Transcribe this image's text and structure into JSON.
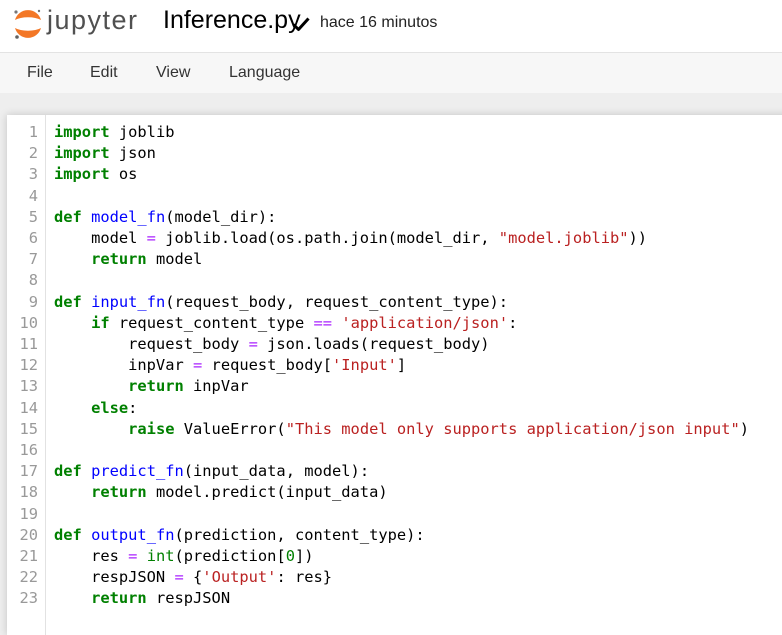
{
  "header": {
    "logo_text": "jupyter",
    "notebook_name": "Inference.py",
    "save_status": "hace 16 minutos"
  },
  "menu": [
    "File",
    "Edit",
    "View",
    "Language"
  ],
  "colors": {
    "keyword": "#008000",
    "function_name": "#0000ff",
    "string": "#ba2121",
    "operator": "#aa22ff",
    "number": "#008000",
    "line_number": "#999999",
    "logo_orange": "#f37726"
  },
  "code": [
    {
      "n": "1",
      "t": [
        {
          "c": "import",
          "k": "kw"
        },
        {
          "c": " joblib",
          "k": "plain"
        }
      ]
    },
    {
      "n": "2",
      "t": [
        {
          "c": "import",
          "k": "kw"
        },
        {
          "c": " json",
          "k": "plain"
        }
      ]
    },
    {
      "n": "3",
      "t": [
        {
          "c": "import",
          "k": "kw"
        },
        {
          "c": " os",
          "k": "plain"
        }
      ]
    },
    {
      "n": "4",
      "t": []
    },
    {
      "n": "5",
      "t": [
        {
          "c": "def",
          "k": "kw"
        },
        {
          "c": " ",
          "k": "plain"
        },
        {
          "c": "model_fn",
          "k": "def"
        },
        {
          "c": "(model_dir):",
          "k": "plain"
        }
      ]
    },
    {
      "n": "6",
      "t": [
        {
          "c": "    model ",
          "k": "plain"
        },
        {
          "c": "=",
          "k": "op"
        },
        {
          "c": " joblib.load(os.path.join(model_dir, ",
          "k": "plain"
        },
        {
          "c": "\"model.joblib\"",
          "k": "str"
        },
        {
          "c": "))",
          "k": "plain"
        }
      ]
    },
    {
      "n": "7",
      "t": [
        {
          "c": "    ",
          "k": "plain"
        },
        {
          "c": "return",
          "k": "kw"
        },
        {
          "c": " model",
          "k": "plain"
        }
      ]
    },
    {
      "n": "8",
      "t": []
    },
    {
      "n": "9",
      "t": [
        {
          "c": "def",
          "k": "kw"
        },
        {
          "c": " ",
          "k": "plain"
        },
        {
          "c": "input_fn",
          "k": "def"
        },
        {
          "c": "(request_body, request_content_type):",
          "k": "plain"
        }
      ]
    },
    {
      "n": "10",
      "t": [
        {
          "c": "    ",
          "k": "plain"
        },
        {
          "c": "if",
          "k": "kw"
        },
        {
          "c": " request_content_type ",
          "k": "plain"
        },
        {
          "c": "==",
          "k": "op"
        },
        {
          "c": " ",
          "k": "plain"
        },
        {
          "c": "'application/json'",
          "k": "str"
        },
        {
          "c": ":",
          "k": "plain"
        }
      ]
    },
    {
      "n": "11",
      "t": [
        {
          "c": "        request_body ",
          "k": "plain"
        },
        {
          "c": "=",
          "k": "op"
        },
        {
          "c": " json.loads(request_body)",
          "k": "plain"
        }
      ]
    },
    {
      "n": "12",
      "t": [
        {
          "c": "        inpVar ",
          "k": "plain"
        },
        {
          "c": "=",
          "k": "op"
        },
        {
          "c": " request_body[",
          "k": "plain"
        },
        {
          "c": "'Input'",
          "k": "str"
        },
        {
          "c": "]",
          "k": "plain"
        }
      ]
    },
    {
      "n": "13",
      "t": [
        {
          "c": "        ",
          "k": "plain"
        },
        {
          "c": "return",
          "k": "kw"
        },
        {
          "c": " inpVar",
          "k": "plain"
        }
      ]
    },
    {
      "n": "14",
      "t": [
        {
          "c": "    ",
          "k": "plain"
        },
        {
          "c": "else",
          "k": "kw"
        },
        {
          "c": ":",
          "k": "plain"
        }
      ]
    },
    {
      "n": "15",
      "t": [
        {
          "c": "        ",
          "k": "plain"
        },
        {
          "c": "raise",
          "k": "kw"
        },
        {
          "c": " ValueError(",
          "k": "plain"
        },
        {
          "c": "\"This model only supports application/json input\"",
          "k": "str"
        },
        {
          "c": ")",
          "k": "plain"
        }
      ]
    },
    {
      "n": "16",
      "t": []
    },
    {
      "n": "17",
      "t": [
        {
          "c": "def",
          "k": "kw"
        },
        {
          "c": " ",
          "k": "plain"
        },
        {
          "c": "predict_fn",
          "k": "def"
        },
        {
          "c": "(input_data, model):",
          "k": "plain"
        }
      ]
    },
    {
      "n": "18",
      "t": [
        {
          "c": "    ",
          "k": "plain"
        },
        {
          "c": "return",
          "k": "kw"
        },
        {
          "c": " model.predict(input_data)",
          "k": "plain"
        }
      ]
    },
    {
      "n": "19",
      "t": []
    },
    {
      "n": "20",
      "t": [
        {
          "c": "def",
          "k": "kw"
        },
        {
          "c": " ",
          "k": "plain"
        },
        {
          "c": "output_fn",
          "k": "def"
        },
        {
          "c": "(prediction, content_type):",
          "k": "plain"
        }
      ]
    },
    {
      "n": "21",
      "t": [
        {
          "c": "    res ",
          "k": "plain"
        },
        {
          "c": "=",
          "k": "op"
        },
        {
          "c": " ",
          "k": "plain"
        },
        {
          "c": "int",
          "k": "builtin"
        },
        {
          "c": "(prediction[",
          "k": "plain"
        },
        {
          "c": "0",
          "k": "num"
        },
        {
          "c": "])",
          "k": "plain"
        }
      ]
    },
    {
      "n": "22",
      "t": [
        {
          "c": "    respJSON ",
          "k": "plain"
        },
        {
          "c": "=",
          "k": "op"
        },
        {
          "c": " {",
          "k": "plain"
        },
        {
          "c": "'Output'",
          "k": "str"
        },
        {
          "c": ": res}",
          "k": "plain"
        }
      ]
    },
    {
      "n": "23",
      "t": [
        {
          "c": "    ",
          "k": "plain"
        },
        {
          "c": "return",
          "k": "kw"
        },
        {
          "c": " respJSON",
          "k": "plain"
        }
      ]
    }
  ]
}
